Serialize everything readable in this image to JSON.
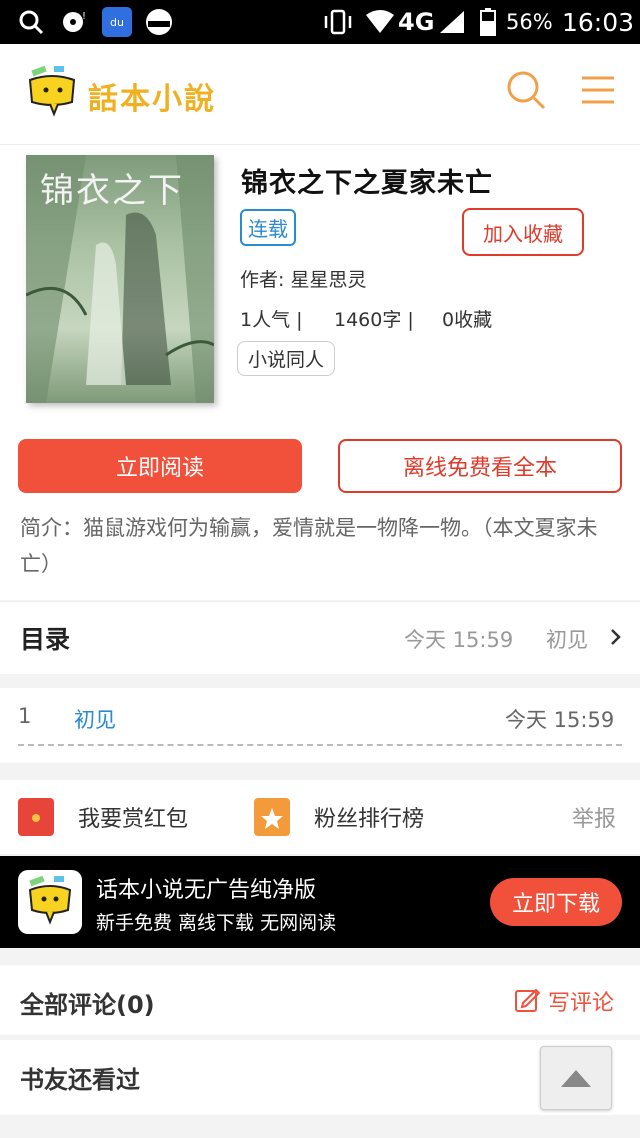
{
  "status_bar": {
    "network": "4G",
    "battery": "56%",
    "time": "16:03"
  },
  "header": {
    "logo_text": "話本小說"
  },
  "book": {
    "title": "锦衣之下之夏家未亡",
    "status_badge": "连载",
    "favorite_button": "加入收藏",
    "author": "作者: 星星思灵",
    "popularity": "1人气 |",
    "word_count": "1460字 |",
    "favorites": "0收藏",
    "tag": "小说同人",
    "cover_title": "锦衣之下"
  },
  "actions": {
    "read_now": "立即阅读",
    "offline_full": "离线免费看全本"
  },
  "intro": "简介：猫鼠游戏何为输赢，爱情就是一物降一物。（本文夏家未亡）",
  "toc": {
    "label": "目录",
    "updated": "今天 15:59",
    "latest_chapter": "初见"
  },
  "chapters": [
    {
      "number": "1",
      "title": "初见",
      "time": "今天 15:59"
    }
  ],
  "reward": {
    "red_packet": "我要赏红包",
    "fan_rank": "粉丝排行榜",
    "report": "举报"
  },
  "promo": {
    "title": "话本小说无广告纯净版",
    "subtitle": "新手免费 离线下载 无网阅读",
    "download": "立即下载"
  },
  "comments": {
    "label": "全部评论(0)",
    "write": "写评论"
  },
  "also_read": {
    "label": "书友还看过"
  },
  "colors": {
    "accent_red": "#f1513a",
    "link_blue": "#2a8bd3",
    "logo_orange": "#f0a04b"
  }
}
